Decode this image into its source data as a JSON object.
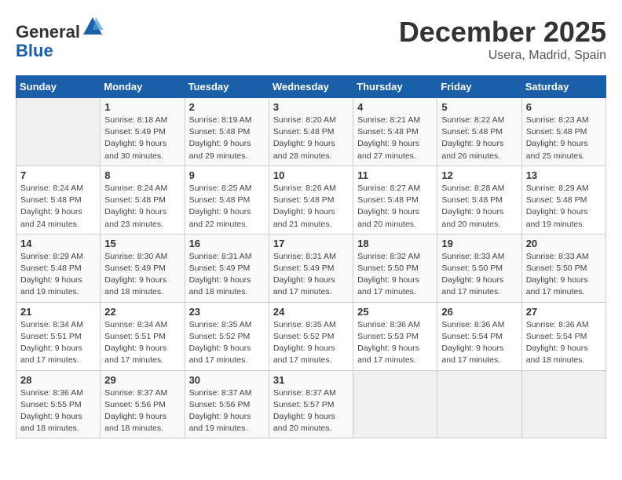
{
  "header": {
    "logo_general": "General",
    "logo_blue": "Blue",
    "month": "December 2025",
    "location": "Usera, Madrid, Spain"
  },
  "days_of_week": [
    "Sunday",
    "Monday",
    "Tuesday",
    "Wednesday",
    "Thursday",
    "Friday",
    "Saturday"
  ],
  "weeks": [
    [
      {
        "day": "",
        "info": ""
      },
      {
        "day": "1",
        "info": "Sunrise: 8:18 AM\nSunset: 5:49 PM\nDaylight: 9 hours\nand 30 minutes."
      },
      {
        "day": "2",
        "info": "Sunrise: 8:19 AM\nSunset: 5:48 PM\nDaylight: 9 hours\nand 29 minutes."
      },
      {
        "day": "3",
        "info": "Sunrise: 8:20 AM\nSunset: 5:48 PM\nDaylight: 9 hours\nand 28 minutes."
      },
      {
        "day": "4",
        "info": "Sunrise: 8:21 AM\nSunset: 5:48 PM\nDaylight: 9 hours\nand 27 minutes."
      },
      {
        "day": "5",
        "info": "Sunrise: 8:22 AM\nSunset: 5:48 PM\nDaylight: 9 hours\nand 26 minutes."
      },
      {
        "day": "6",
        "info": "Sunrise: 8:23 AM\nSunset: 5:48 PM\nDaylight: 9 hours\nand 25 minutes."
      }
    ],
    [
      {
        "day": "7",
        "info": "Sunrise: 8:24 AM\nSunset: 5:48 PM\nDaylight: 9 hours\nand 24 minutes."
      },
      {
        "day": "8",
        "info": "Sunrise: 8:24 AM\nSunset: 5:48 PM\nDaylight: 9 hours\nand 23 minutes."
      },
      {
        "day": "9",
        "info": "Sunrise: 8:25 AM\nSunset: 5:48 PM\nDaylight: 9 hours\nand 22 minutes."
      },
      {
        "day": "10",
        "info": "Sunrise: 8:26 AM\nSunset: 5:48 PM\nDaylight: 9 hours\nand 21 minutes."
      },
      {
        "day": "11",
        "info": "Sunrise: 8:27 AM\nSunset: 5:48 PM\nDaylight: 9 hours\nand 20 minutes."
      },
      {
        "day": "12",
        "info": "Sunrise: 8:28 AM\nSunset: 5:48 PM\nDaylight: 9 hours\nand 20 minutes."
      },
      {
        "day": "13",
        "info": "Sunrise: 8:29 AM\nSunset: 5:48 PM\nDaylight: 9 hours\nand 19 minutes."
      }
    ],
    [
      {
        "day": "14",
        "info": "Sunrise: 8:29 AM\nSunset: 5:48 PM\nDaylight: 9 hours\nand 19 minutes."
      },
      {
        "day": "15",
        "info": "Sunrise: 8:30 AM\nSunset: 5:49 PM\nDaylight: 9 hours\nand 18 minutes."
      },
      {
        "day": "16",
        "info": "Sunrise: 8:31 AM\nSunset: 5:49 PM\nDaylight: 9 hours\nand 18 minutes."
      },
      {
        "day": "17",
        "info": "Sunrise: 8:31 AM\nSunset: 5:49 PM\nDaylight: 9 hours\nand 17 minutes."
      },
      {
        "day": "18",
        "info": "Sunrise: 8:32 AM\nSunset: 5:50 PM\nDaylight: 9 hours\nand 17 minutes."
      },
      {
        "day": "19",
        "info": "Sunrise: 8:33 AM\nSunset: 5:50 PM\nDaylight: 9 hours\nand 17 minutes."
      },
      {
        "day": "20",
        "info": "Sunrise: 8:33 AM\nSunset: 5:50 PM\nDaylight: 9 hours\nand 17 minutes."
      }
    ],
    [
      {
        "day": "21",
        "info": "Sunrise: 8:34 AM\nSunset: 5:51 PM\nDaylight: 9 hours\nand 17 minutes."
      },
      {
        "day": "22",
        "info": "Sunrise: 8:34 AM\nSunset: 5:51 PM\nDaylight: 9 hours\nand 17 minutes."
      },
      {
        "day": "23",
        "info": "Sunrise: 8:35 AM\nSunset: 5:52 PM\nDaylight: 9 hours\nand 17 minutes."
      },
      {
        "day": "24",
        "info": "Sunrise: 8:35 AM\nSunset: 5:52 PM\nDaylight: 9 hours\nand 17 minutes."
      },
      {
        "day": "25",
        "info": "Sunrise: 8:36 AM\nSunset: 5:53 PM\nDaylight: 9 hours\nand 17 minutes."
      },
      {
        "day": "26",
        "info": "Sunrise: 8:36 AM\nSunset: 5:54 PM\nDaylight: 9 hours\nand 17 minutes."
      },
      {
        "day": "27",
        "info": "Sunrise: 8:36 AM\nSunset: 5:54 PM\nDaylight: 9 hours\nand 18 minutes."
      }
    ],
    [
      {
        "day": "28",
        "info": "Sunrise: 8:36 AM\nSunset: 5:55 PM\nDaylight: 9 hours\nand 18 minutes."
      },
      {
        "day": "29",
        "info": "Sunrise: 8:37 AM\nSunset: 5:56 PM\nDaylight: 9 hours\nand 18 minutes."
      },
      {
        "day": "30",
        "info": "Sunrise: 8:37 AM\nSunset: 5:56 PM\nDaylight: 9 hours\nand 19 minutes."
      },
      {
        "day": "31",
        "info": "Sunrise: 8:37 AM\nSunset: 5:57 PM\nDaylight: 9 hours\nand 20 minutes."
      },
      {
        "day": "",
        "info": ""
      },
      {
        "day": "",
        "info": ""
      },
      {
        "day": "",
        "info": ""
      }
    ]
  ]
}
